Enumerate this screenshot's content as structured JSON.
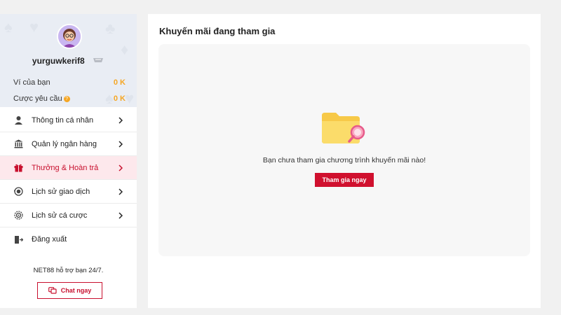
{
  "profile": {
    "username": "yurguwkerif8",
    "wallet_label": "Ví của bạn",
    "wallet_value": "0 K",
    "bet_required_label": "Cược yêu cầu",
    "bet_required_value": "0 K"
  },
  "menu": {
    "items": [
      {
        "label": "Thông tin cá nhân",
        "icon": "user-icon"
      },
      {
        "label": "Quản lý ngân hàng",
        "icon": "bank-icon"
      },
      {
        "label": "Thưởng & Hoàn trả",
        "icon": "gift-icon",
        "active": true
      },
      {
        "label": "Lịch sử giao dịch",
        "icon": "transaction-history-icon"
      },
      {
        "label": "Lịch sử cá cược",
        "icon": "bet-history-icon"
      },
      {
        "label": "Đăng xuất",
        "icon": "logout-icon"
      }
    ]
  },
  "support": {
    "text": "NET88 hỗ trợ bạn 24/7.",
    "chat_label": "Chat ngay"
  },
  "main": {
    "title": "Khuyến mãi đang tham gia",
    "empty_message": "Bạn chưa tham gia chương trình khuyến mãi nào!",
    "join_label": "Tham gia ngay"
  },
  "colors": {
    "accent": "#d0102e",
    "wallet_value": "#f5a623",
    "active_bg": "#fde8ec"
  }
}
